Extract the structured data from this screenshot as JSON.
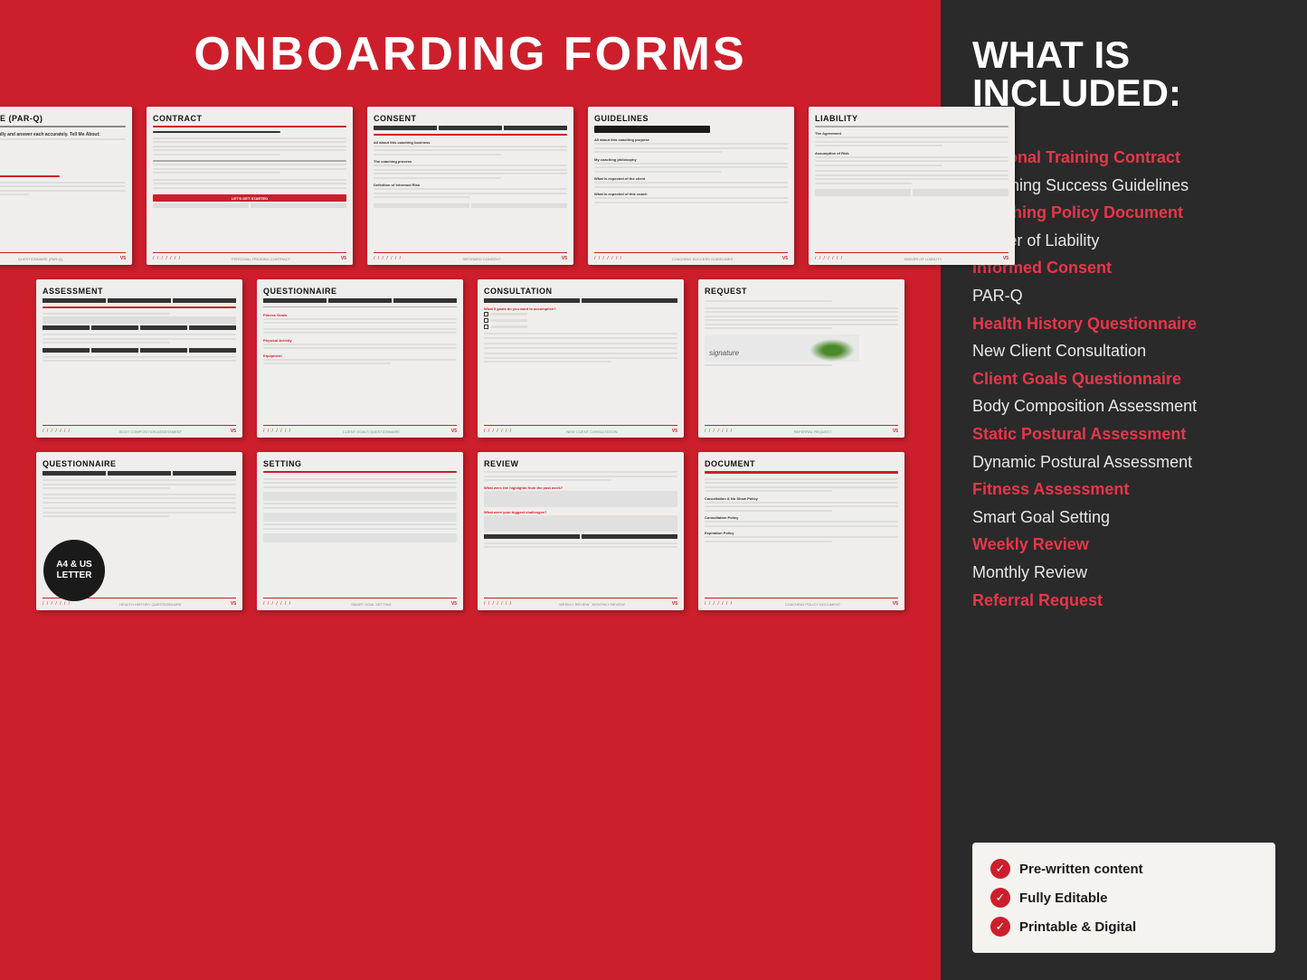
{
  "left": {
    "title": "ONBOARDING FORMS",
    "badge": "A4 & US\nLETTER"
  },
  "right": {
    "title": "WHAT IS\nINCLUDED:",
    "items": [
      {
        "label": "Personal Training Contract",
        "style": "red"
      },
      {
        "label": "Coaching Success Guidelines",
        "style": "white"
      },
      {
        "label": "Coaching Policy Document",
        "style": "red"
      },
      {
        "label": "Waiver of Liability",
        "style": "white"
      },
      {
        "label": "Informed Consent",
        "style": "red"
      },
      {
        "label": "PAR-Q",
        "style": "white"
      },
      {
        "label": "Health History Questionnaire",
        "style": "red"
      },
      {
        "label": "New Client Consultation",
        "style": "white"
      },
      {
        "label": "Client Goals Questionnaire",
        "style": "red"
      },
      {
        "label": "Body Composition Assessment",
        "style": "white"
      },
      {
        "label": "Static Postural Assessment",
        "style": "red"
      },
      {
        "label": "Dynamic Postural Assessment",
        "style": "white"
      },
      {
        "label": "Fitness Assessment",
        "style": "red"
      },
      {
        "label": "Smart Goal Setting",
        "style": "white"
      },
      {
        "label": "Weekly Review",
        "style": "red"
      },
      {
        "label": "Monthly Review",
        "style": "white"
      },
      {
        "label": "Referral Request",
        "style": "red"
      }
    ],
    "features": [
      "Pre-written content",
      "Fully Editable",
      "Printable & Digital"
    ]
  },
  "docs": {
    "row1": [
      {
        "title": "QUESTIONNAIRE (PAR-Q)",
        "type": "parq"
      },
      {
        "title": "CONTRACT",
        "type": "contract"
      },
      {
        "title": "CONSENT",
        "type": "consent"
      },
      {
        "title": "GUIDELINES",
        "type": "guidelines"
      },
      {
        "title": "LIABILITY",
        "type": "liability"
      }
    ],
    "row2": [
      {
        "title": "ASSESSMENT",
        "type": "assessment"
      },
      {
        "title": "QUESTIONNAIRE",
        "type": "questionnaire2"
      },
      {
        "title": "CONSULTATION",
        "type": "consultation"
      },
      {
        "title": "REQUEST",
        "type": "request"
      }
    ],
    "row3": [
      {
        "title": "QUESTIONNAIRE",
        "type": "questionnaire3",
        "badge": true
      },
      {
        "title": "SETTING",
        "type": "setting"
      },
      {
        "title": "REVIEW",
        "type": "review"
      },
      {
        "title": "DOCUMENT",
        "type": "document"
      }
    ]
  }
}
